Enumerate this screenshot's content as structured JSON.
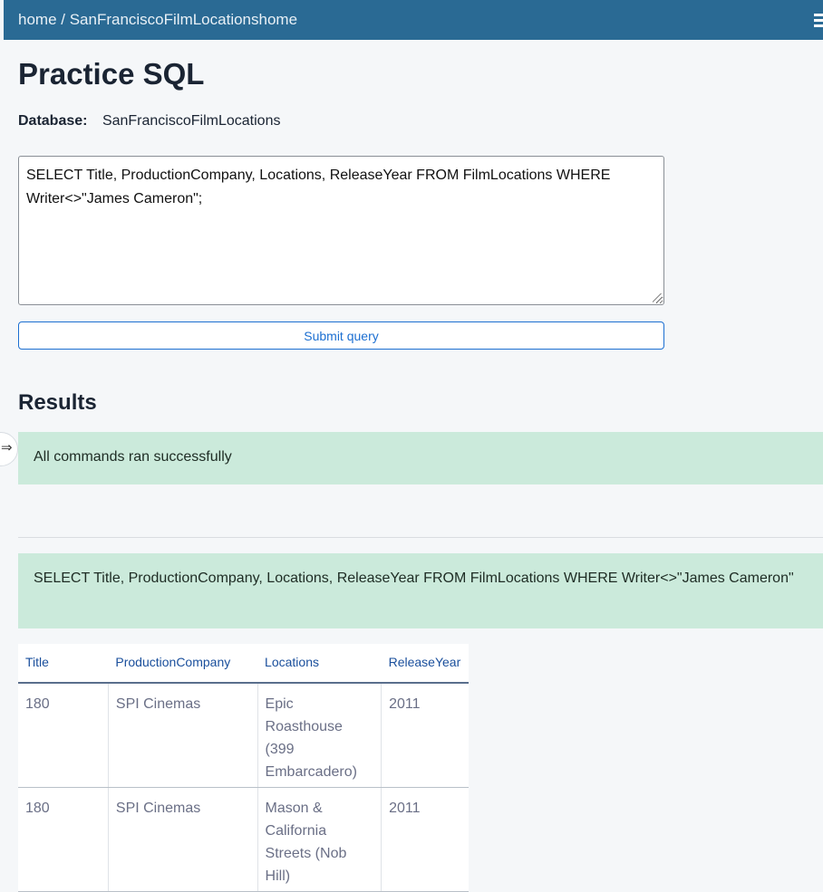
{
  "breadcrumb": {
    "text": "home / SanFranciscoFilmLocationshome"
  },
  "page": {
    "title": "Practice SQL",
    "database_label": "Database:",
    "database_value": "SanFranciscoFilmLocations"
  },
  "query": {
    "value": "SELECT Title, ProductionCompany, Locations, ReleaseYear FROM FilmLocations WHERE Writer<>\"James Cameron\";",
    "submit_label": "Submit query"
  },
  "results": {
    "heading": "Results",
    "status_message": "All commands ran successfully",
    "executed_statement": "SELECT Title, ProductionCompany, Locations, ReleaseYear FROM FilmLocations WHERE Writer<>\"James Cameron\"",
    "columns": [
      "Title",
      "ProductionCompany",
      "Locations",
      "ReleaseYear"
    ],
    "rows": [
      [
        "180",
        "SPI Cinemas",
        "Epic Roasthouse (399 Embarcadero)",
        "2011"
      ],
      [
        "180",
        "SPI Cinemas",
        "Mason & California Streets (Nob Hill)",
        "2011"
      ]
    ]
  },
  "icons": {
    "menu": "hamburger-menu-icon",
    "sidebar_toggle": "arrow-right-icon"
  },
  "colors": {
    "topbar": "#2a6a94",
    "accent": "#1c6fd1",
    "success_bg": "#cbeadb"
  }
}
